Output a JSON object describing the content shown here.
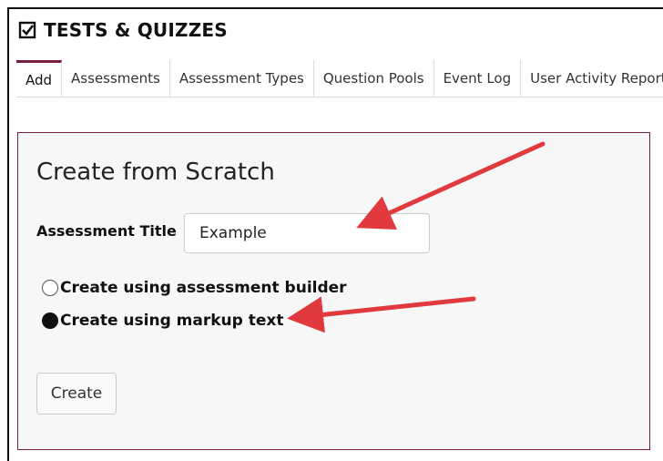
{
  "tool": {
    "title": "TESTS & QUIZZES"
  },
  "tabs": [
    {
      "label": "Add",
      "active": true
    },
    {
      "label": "Assessments"
    },
    {
      "label": "Assessment Types"
    },
    {
      "label": "Question Pools"
    },
    {
      "label": "Event Log"
    },
    {
      "label": "User Activity Report"
    }
  ],
  "panel": {
    "title": "Create from Scratch",
    "assessment_title_label": "Assessment Title",
    "assessment_title_value": "Example",
    "options": [
      {
        "label": "Create using assessment builder",
        "checked": false
      },
      {
        "label": "Create using markup text",
        "checked": true
      }
    ],
    "create_label": "Create"
  },
  "colors": {
    "accent": "#7b1d3a",
    "annotation_arrow": "#e0393e"
  }
}
